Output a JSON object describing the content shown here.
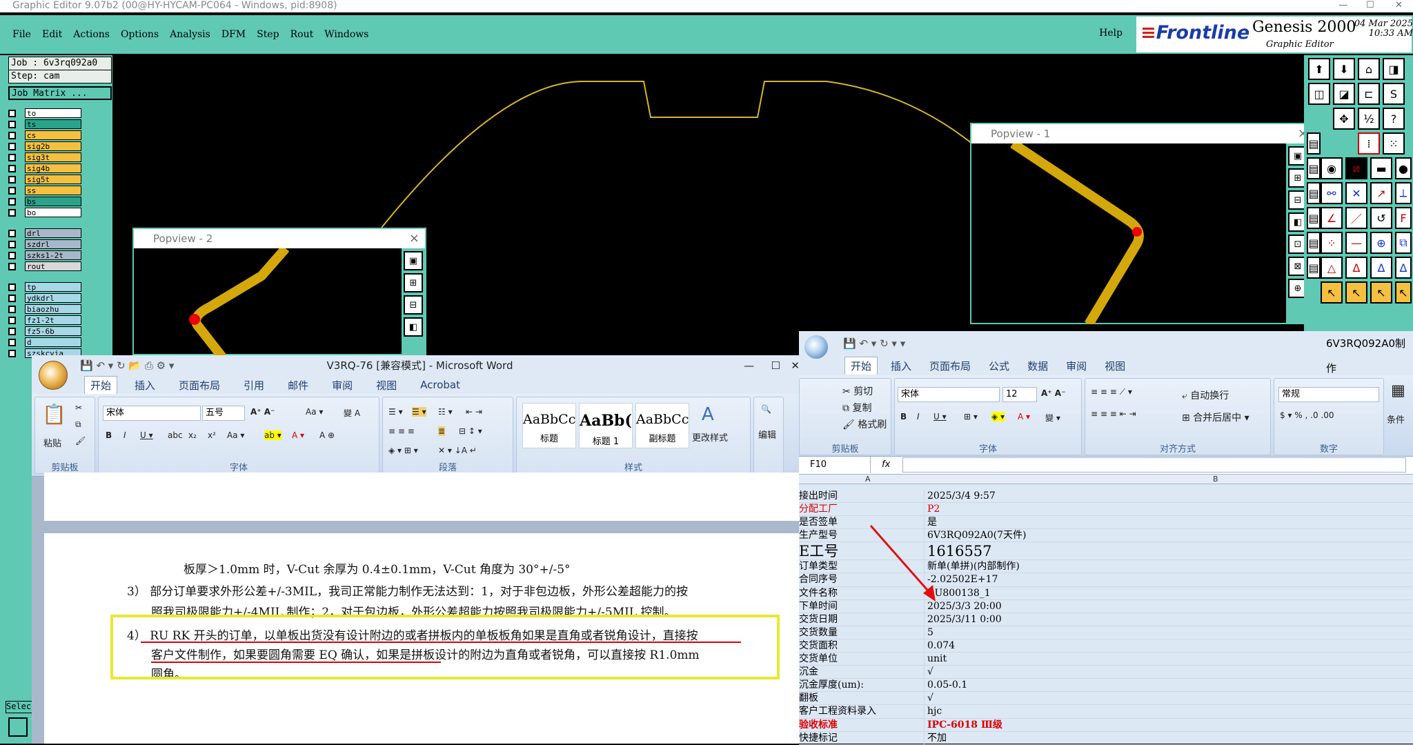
{
  "ge": {
    "title": "Graphic Editor 9.07b2 (00@HY-HYCAM-PC064 - Windows, pid:8908)",
    "menu": [
      "File",
      "Edit",
      "Actions",
      "Options",
      "Analysis",
      "DFM",
      "Step",
      "Rout",
      "Windows"
    ],
    "help": "Help",
    "brand": "Frontline",
    "product": "Genesis 2000",
    "product_sub": "Graphic Editor",
    "date": "04 Mar 2025",
    "time": "10:33 AM",
    "job_label": "Job : 6v3rq092a0",
    "step_label": "Step: cam",
    "job_matrix": "Job Matrix ...",
    "layers_group1": [
      {
        "name": "to",
        "color": "#ffffff"
      },
      {
        "name": "ts",
        "color": "#2aa38a"
      },
      {
        "name": "cs",
        "color": "#f5c040"
      },
      {
        "name": "sig2b",
        "color": "#f5c040"
      },
      {
        "name": "sig3t",
        "color": "#f5c040"
      },
      {
        "name": "sig4b",
        "color": "#f5c040"
      },
      {
        "name": "sig5t",
        "color": "#f5c040"
      },
      {
        "name": "ss",
        "color": "#f5c040"
      },
      {
        "name": "bs",
        "color": "#2aa38a"
      },
      {
        "name": "bo",
        "color": "#ffffff"
      }
    ],
    "layers_group2": [
      {
        "name": "drl",
        "color": "#a8b8c8"
      },
      {
        "name": "szdrl",
        "color": "#a8b8c8"
      },
      {
        "name": "szks1-2t",
        "color": "#a8b8c8"
      },
      {
        "name": "rout",
        "color": "#d8d8d8"
      }
    ],
    "layers_group3": [
      {
        "name": "tp",
        "color": "#a8d8e8"
      },
      {
        "name": "ydkdrl",
        "color": "#a8d8e8"
      },
      {
        "name": "biaozhu",
        "color": "#a8d8e8"
      },
      {
        "name": "fz1-2t",
        "color": "#a8d8e8"
      },
      {
        "name": "fz5-6b",
        "color": "#a8d8e8"
      },
      {
        "name": "d",
        "color": "#a8d8e8"
      },
      {
        "name": "szskcvia",
        "color": "#a8d8e8"
      }
    ],
    "select_label": "Selec",
    "popview1_title": "Popview - 1",
    "popview2_title": "Popview - 2"
  },
  "word": {
    "title": "V3RQ-76 [兼容模式] - Microsoft Word",
    "tabs": [
      "开始",
      "插入",
      "页面布局",
      "引用",
      "邮件",
      "审阅",
      "视图",
      "Acrobat"
    ],
    "font_name": "宋体",
    "font_size": "五号",
    "paste": "粘贴",
    "groups": [
      "剪贴板",
      "字体",
      "段落",
      "样式",
      "编辑"
    ],
    "styles": [
      {
        "sample": "AaBbCc",
        "label": "标题"
      },
      {
        "sample": "AaBb(",
        "label": "标题 1"
      },
      {
        "sample": "AaBbCc",
        "label": "副标题"
      }
    ],
    "change_styles": "更改样式",
    "edit": "编辑",
    "lines": [
      "板厚＞1.0mm 时，V-Cut 余厚为 0.4±0.1mm，V-Cut 角度为 30°+/-5°",
      "3） 部分订单要求外形公差+/-3MIL，我司正常能力制作无法达到：1，对于非包边板，外形公差超能力的按",
      "照我司极限能力+/-4MIL 制作；2，对于包边板，外形公差超能力按照我司极限能力+/-5MIL 控制。",
      "4） RU RK 开头的订单，以单板出货没有设计附边的或者拼板内的单板板角如果是直角或者锐角设计，直接按",
      "客户文件制作，如果要圆角需要 EQ 确认，如果是拼板设计的附边为直角或者锐角，可以直接按 R1.0mm",
      "圆角。"
    ]
  },
  "excel": {
    "title": "6V3RQ092A0制作",
    "tabs": [
      "开始",
      "插入",
      "页面布局",
      "公式",
      "数据",
      "审阅",
      "视图"
    ],
    "cut": "剪切",
    "copy": "复制",
    "format_painter": "格式刷",
    "font_name": "宋体",
    "font_size": "12",
    "wrap": "自动换行",
    "merge": "合并后居中",
    "number_format": "常规",
    "conditional": "条件",
    "groups": [
      "剪贴板",
      "字体",
      "对齐方式",
      "数字"
    ],
    "cell_ref": "F10",
    "fx": "fx",
    "col_a": "A",
    "col_b": "B",
    "rows": [
      {
        "a": "接出时间",
        "b": "2025/3/4 9:57"
      },
      {
        "a": "分配工厂",
        "b": "P2",
        "red": true
      },
      {
        "a": "是否签单",
        "b": "是"
      },
      {
        "a": "生产型号",
        "b": "6V3RQ092A0(7天件)"
      },
      {
        "a": "E工号",
        "b": "1616557",
        "big": true
      },
      {
        "a": "订单类型",
        "b": "新单(单拼)(内部制作)"
      },
      {
        "a": "合同序号",
        "b": "-2.02502E+17"
      },
      {
        "a": "文件名称",
        "b": "RU800138_1"
      },
      {
        "a": "下单时间",
        "b": "2025/3/3 20:00"
      },
      {
        "a": "交货日期",
        "b": "2025/3/11 0:00"
      },
      {
        "a": "交货数量",
        "b": "5"
      },
      {
        "a": "交货面积",
        "b": "0.074"
      },
      {
        "a": "交货单位",
        "b": "unit"
      },
      {
        "a": "沉金",
        "b": "√"
      },
      {
        "a": "沉金厚度(um):",
        "b": "0.05-0.1"
      },
      {
        "a": "翻板",
        "b": "√"
      },
      {
        "a": "客户工程资料录入",
        "b": "hjc"
      },
      {
        "a": "验收标准",
        "b": "IPC-6018 Ⅲ级",
        "red": true,
        "bold": true
      },
      {
        "a": "快捷标记",
        "b": "不加"
      }
    ]
  }
}
